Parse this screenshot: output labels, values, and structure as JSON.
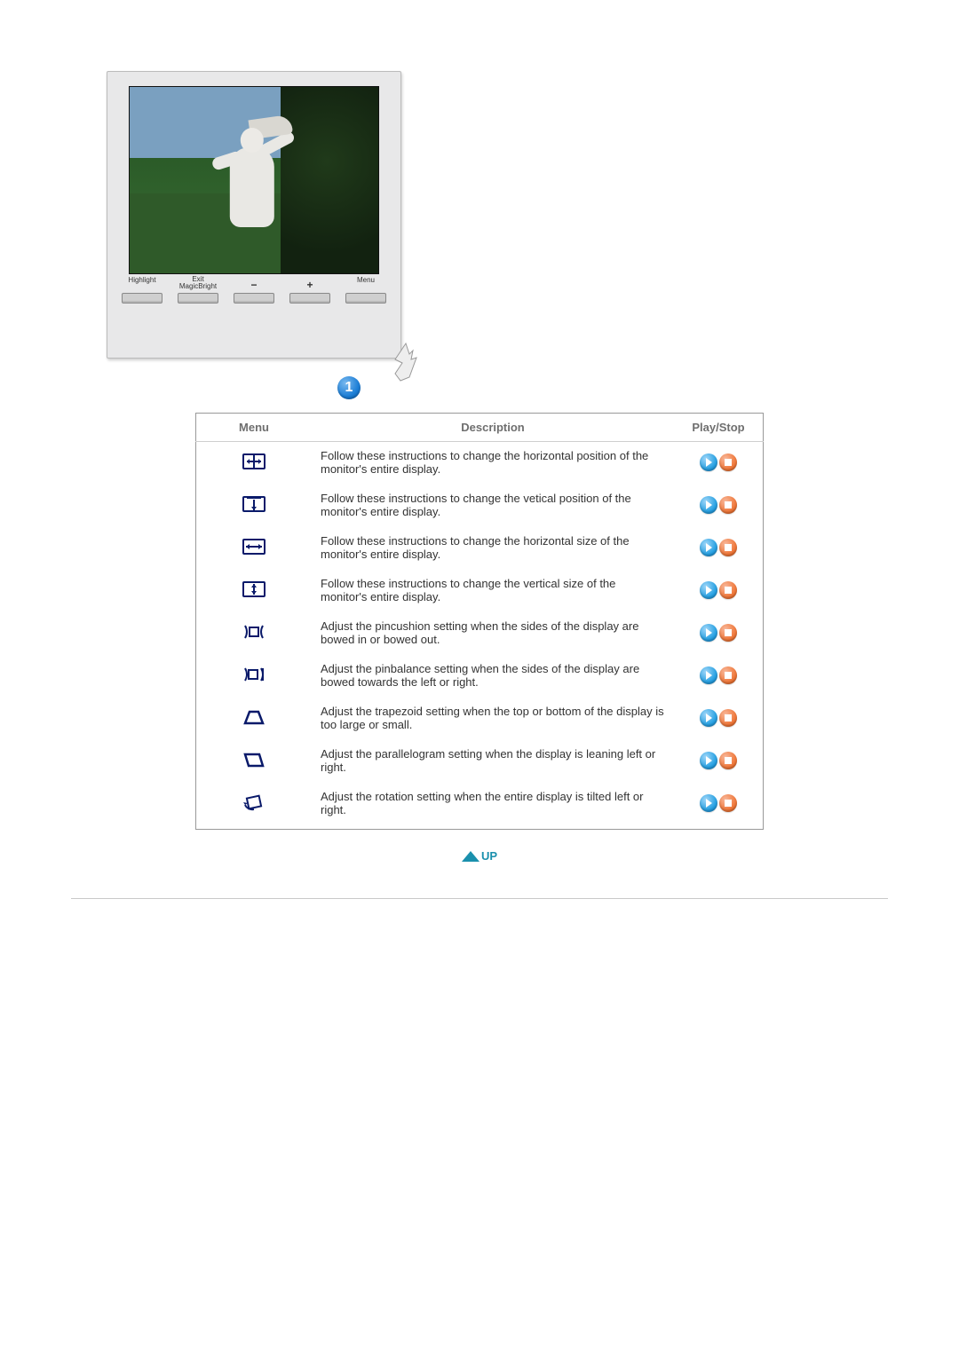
{
  "monitor_buttons": [
    {
      "label": "Highlight",
      "sign": ""
    },
    {
      "label": "Exit\nMagicBright",
      "sign": ""
    },
    {
      "label": "",
      "sign": "−"
    },
    {
      "label": "",
      "sign": "+"
    },
    {
      "label": "Menu",
      "sign": ""
    }
  ],
  "badge_number": "1",
  "table": {
    "headers": {
      "menu": "Menu",
      "description": "Description",
      "playstop": "Play/Stop"
    },
    "rows": [
      {
        "icon": "h-position",
        "desc": "Follow these instructions to change the horizontal position of the monitor's entire display."
      },
      {
        "icon": "v-position",
        "desc": "Follow these instructions to change the vetical position of the monitor's entire display."
      },
      {
        "icon": "h-size",
        "desc": "Follow these instructions to change the horizontal size of the monitor's entire display."
      },
      {
        "icon": "v-size",
        "desc": "Follow these instructions to change the vertical size of the monitor's entire display."
      },
      {
        "icon": "pincushion",
        "desc": "Adjust the pincushion setting when the sides of the display are bowed in or bowed out."
      },
      {
        "icon": "pinbalance",
        "desc": "Adjust the pinbalance setting when the sides of the display are bowed towards the left or right."
      },
      {
        "icon": "trapezoid",
        "desc": "Adjust the trapezoid setting when the top or bottom of the display is too large or small."
      },
      {
        "icon": "parallelogram",
        "desc": "Adjust the parallelogram setting when the display is leaning left or right."
      },
      {
        "icon": "rotation",
        "desc": "Adjust the rotation setting when the entire display is tilted left or right."
      }
    ]
  },
  "up_label": "UP"
}
